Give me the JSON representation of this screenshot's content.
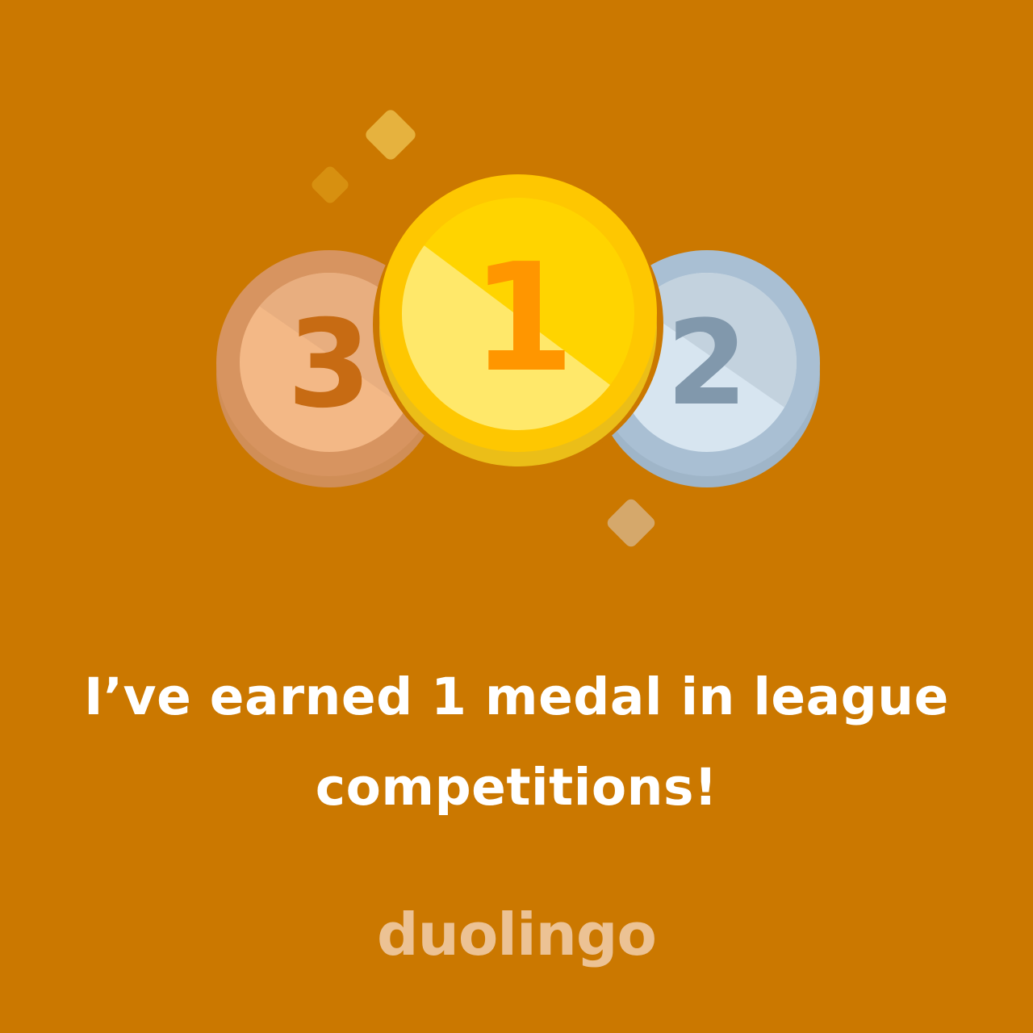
{
  "medals": [
    {
      "rank": "3",
      "tier": "bronze"
    },
    {
      "rank": "1",
      "tier": "gold"
    },
    {
      "rank": "2",
      "tier": "silver"
    }
  ],
  "colors": {
    "background": "#cb7800",
    "headline": "#ffffff",
    "wordmark": "#ecc294",
    "gold": "#ffd400",
    "silver": "#c3d2de",
    "bronze": "#f3b886"
  },
  "icons": [
    "sparkle-icon",
    "sparkle-icon",
    "sparkle-icon"
  ],
  "share_card": {
    "headline": "I’ve earned 1 medal in league competitions!",
    "brand": "duolingo"
  }
}
